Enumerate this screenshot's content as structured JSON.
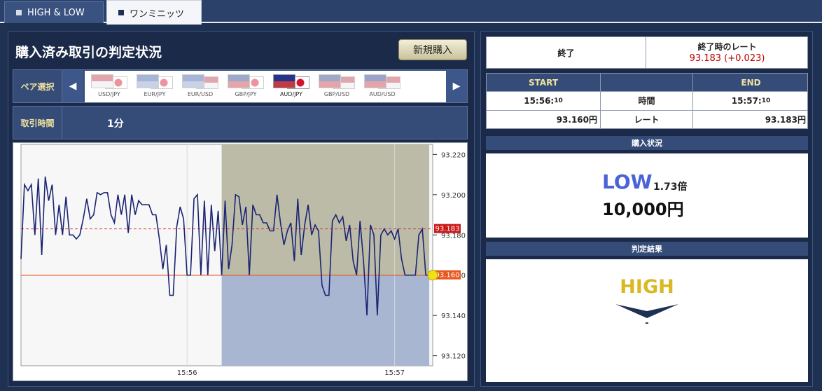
{
  "tabs": [
    {
      "label": "HIGH & LOW"
    },
    {
      "label": "ワンミニッツ"
    }
  ],
  "left": {
    "title": "購入済み取引の判定状況",
    "new_purchase_label": "新規購入",
    "pair_select_label": "ペア選択",
    "pairs": [
      "USD/JPY",
      "EUR/JPY",
      "EUR/USD",
      "GBP/JPY",
      "AUD/JPY",
      "GBP/USD",
      "AUD/USD"
    ],
    "selected_pair": "AUD/JPY",
    "trade_time_label": "取引時間",
    "trade_time_value": "1分"
  },
  "colors": {
    "line": "#1a2472",
    "ref_line": "#e85a2a",
    "current_line": "#d33b3b",
    "upper_zone": "#bcbba8",
    "lower_zone": "#a9b6d2",
    "low_text": "#4a63d6",
    "high_text": "#d9b822"
  },
  "chart_data": {
    "type": "line",
    "title": "",
    "xlabel": "",
    "ylabel": "",
    "x_ticks": [
      "15:56",
      "15:57"
    ],
    "y_ticks": [
      93.22,
      93.2,
      93.18,
      93.16,
      93.14,
      93.12
    ],
    "y_tick_labels": [
      "93.220",
      "93.200",
      "93.180",
      "93.160",
      "93.140",
      "93.120"
    ],
    "ylim": [
      93.115,
      93.225
    ],
    "x_range_seconds": [
      -48,
      71
    ],
    "reference_rate": 93.16,
    "reference_label": "93.160",
    "current_rate": 93.183,
    "current_label": "93.183",
    "window_seconds": [
      10,
      70
    ],
    "series": [
      {
        "x": [
          -48,
          -47,
          -46,
          -45,
          -44,
          -43,
          -42,
          -41,
          -40,
          -39,
          -38,
          -37,
          -36,
          -35,
          -34,
          -33,
          -32,
          -31,
          -30,
          -29,
          -28,
          -27,
          -26,
          -25,
          -24,
          -23,
          -22,
          -21,
          -20,
          -19,
          -18,
          -17,
          -16,
          -15,
          -14,
          -13,
          -12,
          -11,
          -10,
          -9,
          -8,
          -7,
          -6,
          -5,
          -4,
          -3,
          -2,
          -1,
          0,
          1,
          2,
          3,
          4,
          5,
          6,
          7,
          8,
          9,
          10,
          11,
          12,
          13,
          14,
          15,
          16,
          17,
          18,
          19,
          20,
          21,
          22,
          23,
          24,
          25,
          26,
          27,
          28,
          29,
          30,
          31,
          32,
          33,
          34,
          35,
          36,
          37,
          38,
          39,
          40,
          41,
          42,
          43,
          44,
          45,
          46,
          47,
          48,
          49,
          50,
          51,
          52,
          53,
          54,
          55,
          56,
          57,
          58,
          59,
          60,
          61,
          62,
          63,
          64,
          65,
          66,
          67,
          68,
          69,
          70,
          71
        ],
        "y": [
          93.168,
          93.205,
          93.202,
          93.205,
          93.18,
          93.208,
          93.17,
          93.209,
          93.197,
          93.205,
          93.18,
          93.195,
          93.18,
          93.199,
          93.18,
          93.18,
          93.178,
          93.18,
          93.188,
          93.198,
          93.188,
          93.19,
          93.201,
          93.2,
          93.201,
          93.201,
          93.19,
          93.186,
          93.2,
          93.19,
          93.2,
          93.181,
          93.2,
          93.19,
          93.197,
          93.195,
          93.195,
          93.195,
          93.19,
          93.19,
          93.178,
          93.163,
          93.175,
          93.15,
          93.15,
          93.184,
          93.194,
          93.188,
          93.16,
          93.16,
          93.198,
          93.2,
          93.16,
          93.197,
          93.16,
          93.195,
          93.172,
          93.192,
          93.16,
          93.197,
          93.163,
          93.175,
          93.2,
          93.199,
          93.185,
          93.194,
          93.16,
          93.195,
          93.19,
          93.19,
          93.186,
          93.186,
          93.182,
          93.182,
          93.2,
          93.186,
          93.175,
          93.182,
          93.186,
          93.167,
          93.198,
          93.17,
          93.185,
          93.195,
          93.18,
          93.185,
          93.182,
          93.155,
          93.15,
          93.15,
          93.187,
          93.19,
          93.186,
          93.189,
          93.177,
          93.185,
          93.167,
          93.16,
          93.187,
          93.167,
          93.14,
          93.185,
          93.18,
          93.14,
          93.18,
          93.183,
          93.18,
          93.182,
          93.178,
          93.183,
          93.168,
          93.16,
          93.16,
          93.16,
          93.16,
          93.18,
          93.183,
          93.16,
          93.16,
          93.16
        ]
      }
    ],
    "current_point": {
      "x": 71,
      "y": 93.16
    }
  },
  "right": {
    "end_label": "終了",
    "end_rate_label": "終了時のレート",
    "end_rate_value": "93.183 (+0.023)",
    "start_header": "START",
    "end_header": "END",
    "start_time_main": "15:56:",
    "start_time_sec": "10",
    "time_label": "時間",
    "end_time_main": "15:57:",
    "end_time_sec": "10",
    "start_rate": "93.160円",
    "rate_label": "レート",
    "end_rate": "93.183円",
    "purchase_status_label": "購入状況",
    "direction": "LOW",
    "payout": "1.73倍",
    "amount": "10,000円",
    "result_label": "判定結果",
    "result": "HIGH",
    "result_sub": "-"
  }
}
